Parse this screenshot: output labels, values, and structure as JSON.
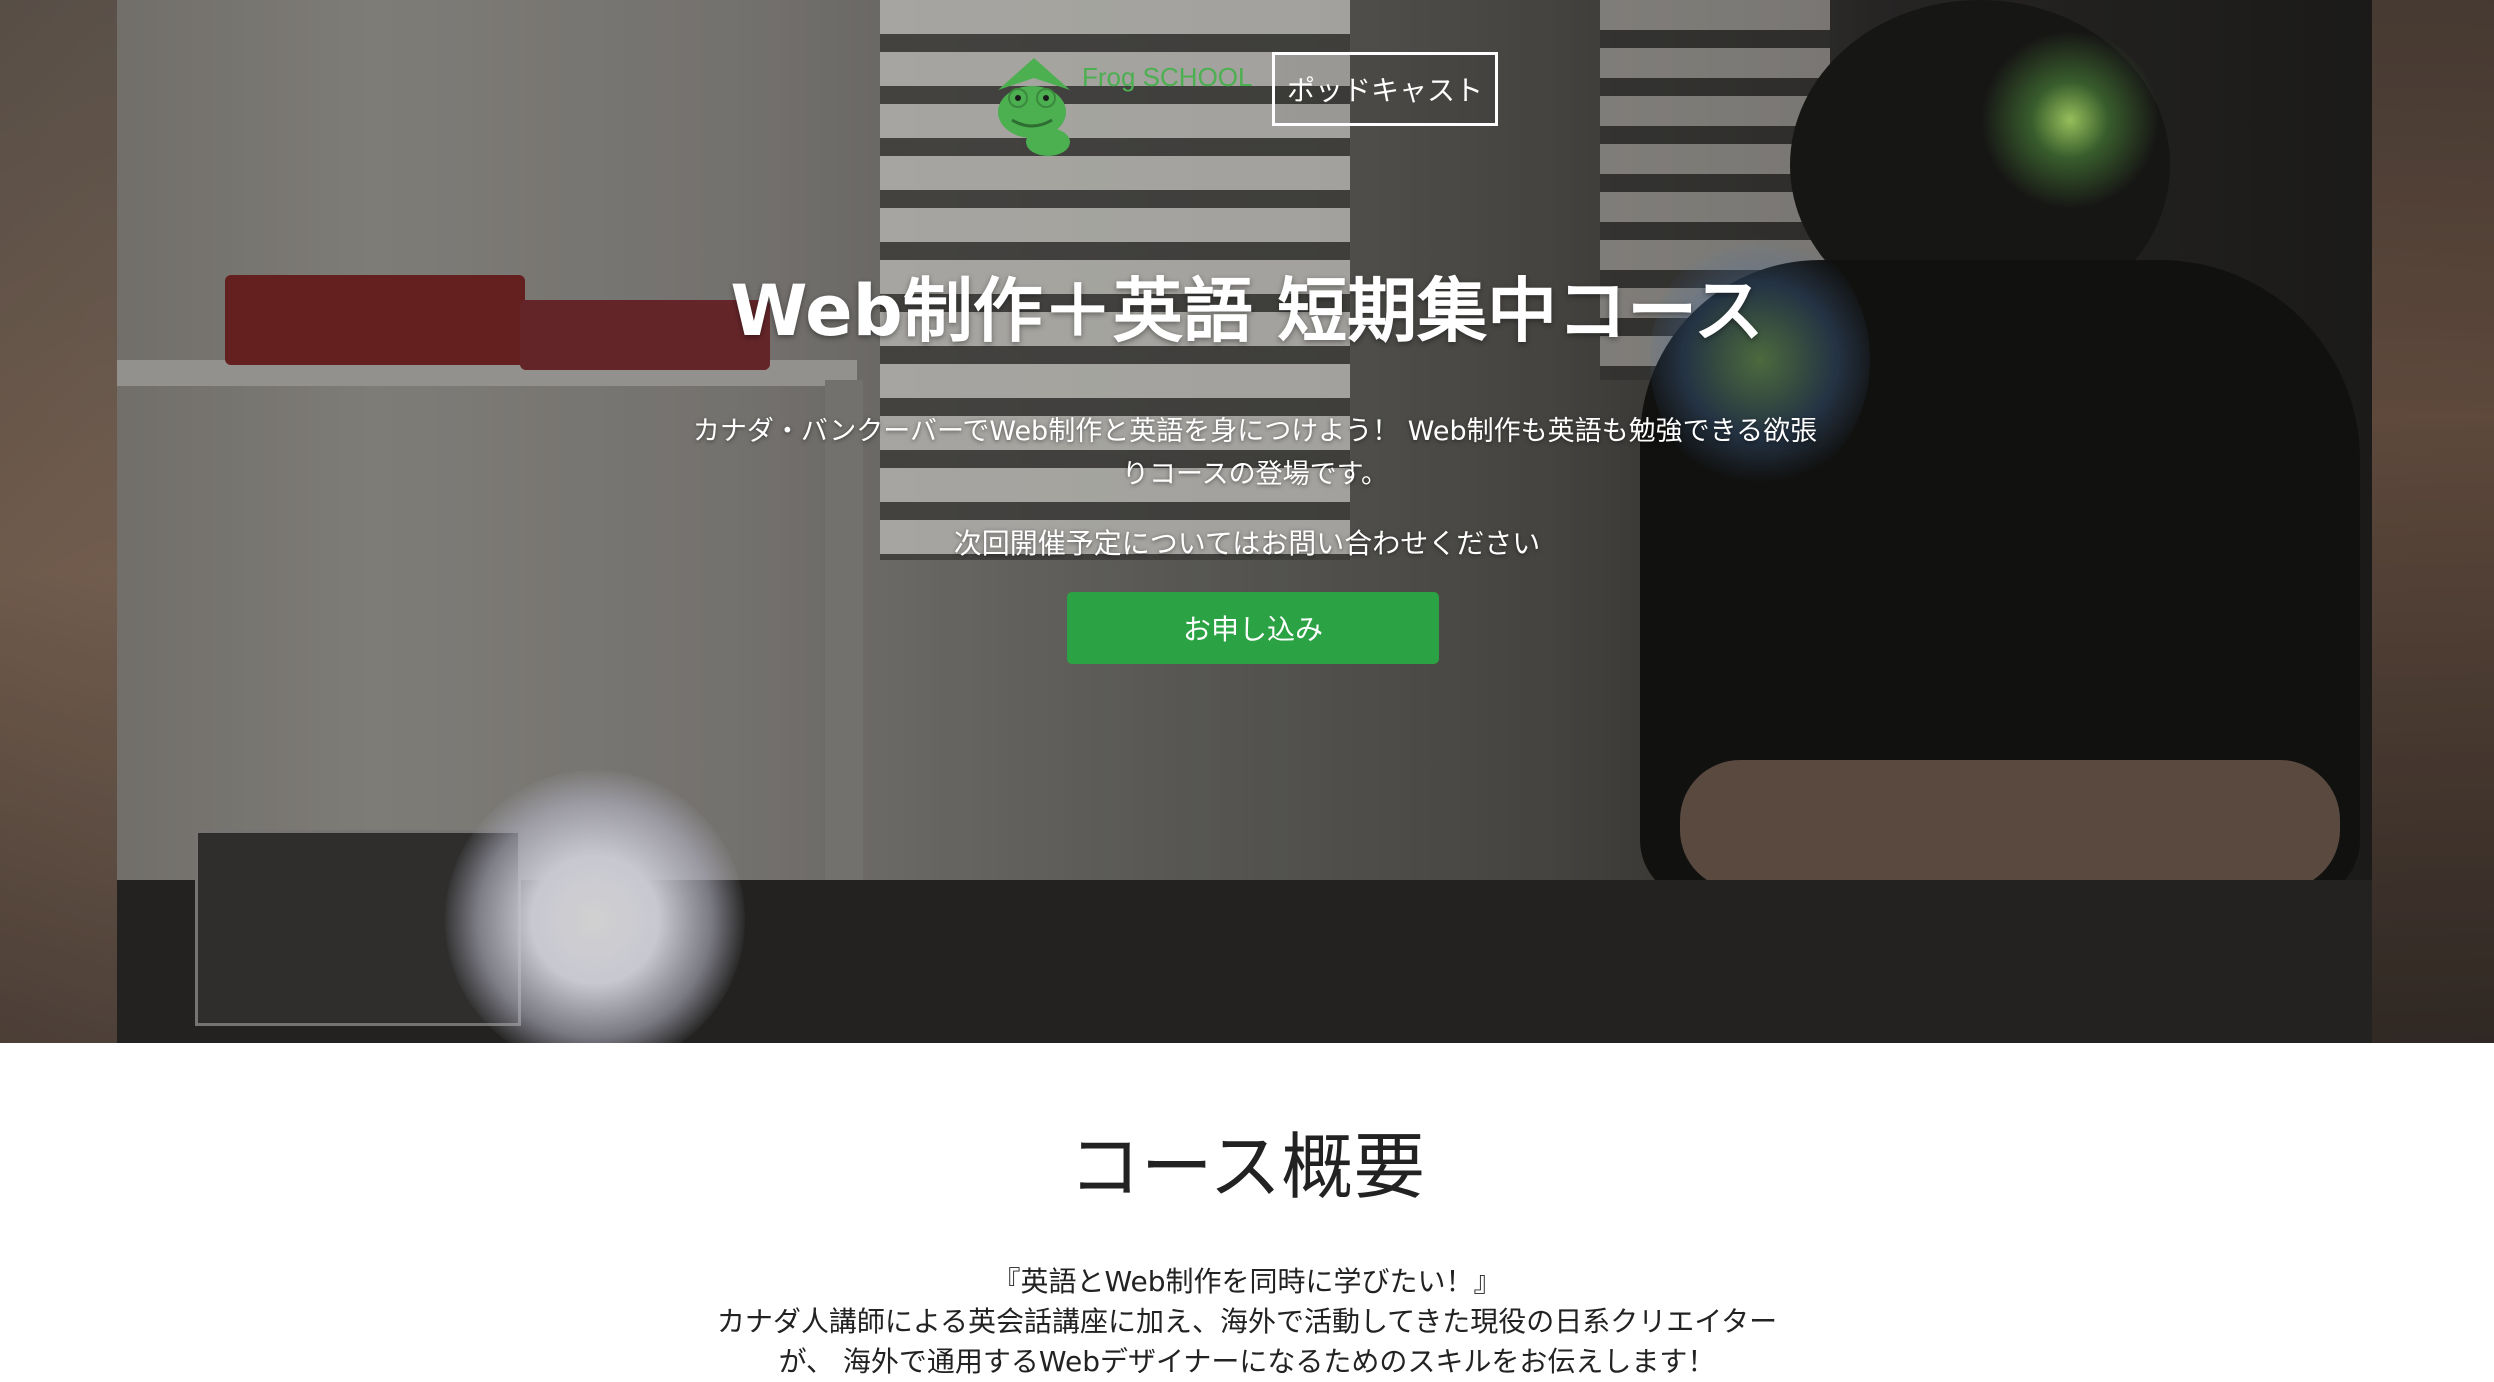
{
  "header": {
    "logo_text": "Frog SCHOOL",
    "podcast_button": "ポッドキャスト"
  },
  "hero": {
    "title": "Web制作＋英語 短期集中コース",
    "description": "カナダ・バンクーバーでWeb制作と英語を身につけよう！ Web制作も英語も勉強できる欲張りコースの登場です。",
    "note": "次回開催予定についてはお問い合わせください",
    "apply_button": "お申し込み",
    "accent_color": "#2ba243"
  },
  "overview": {
    "title": "コース概要",
    "line1": "『英語とWeb制作を同時に学びたい！』",
    "line2": "カナダ人講師による英会話講座に加え、海外で活動してきた現役の日系クリエイターが、 海外で通用するWebデザイナーになるためのスキルをお伝えします！"
  }
}
